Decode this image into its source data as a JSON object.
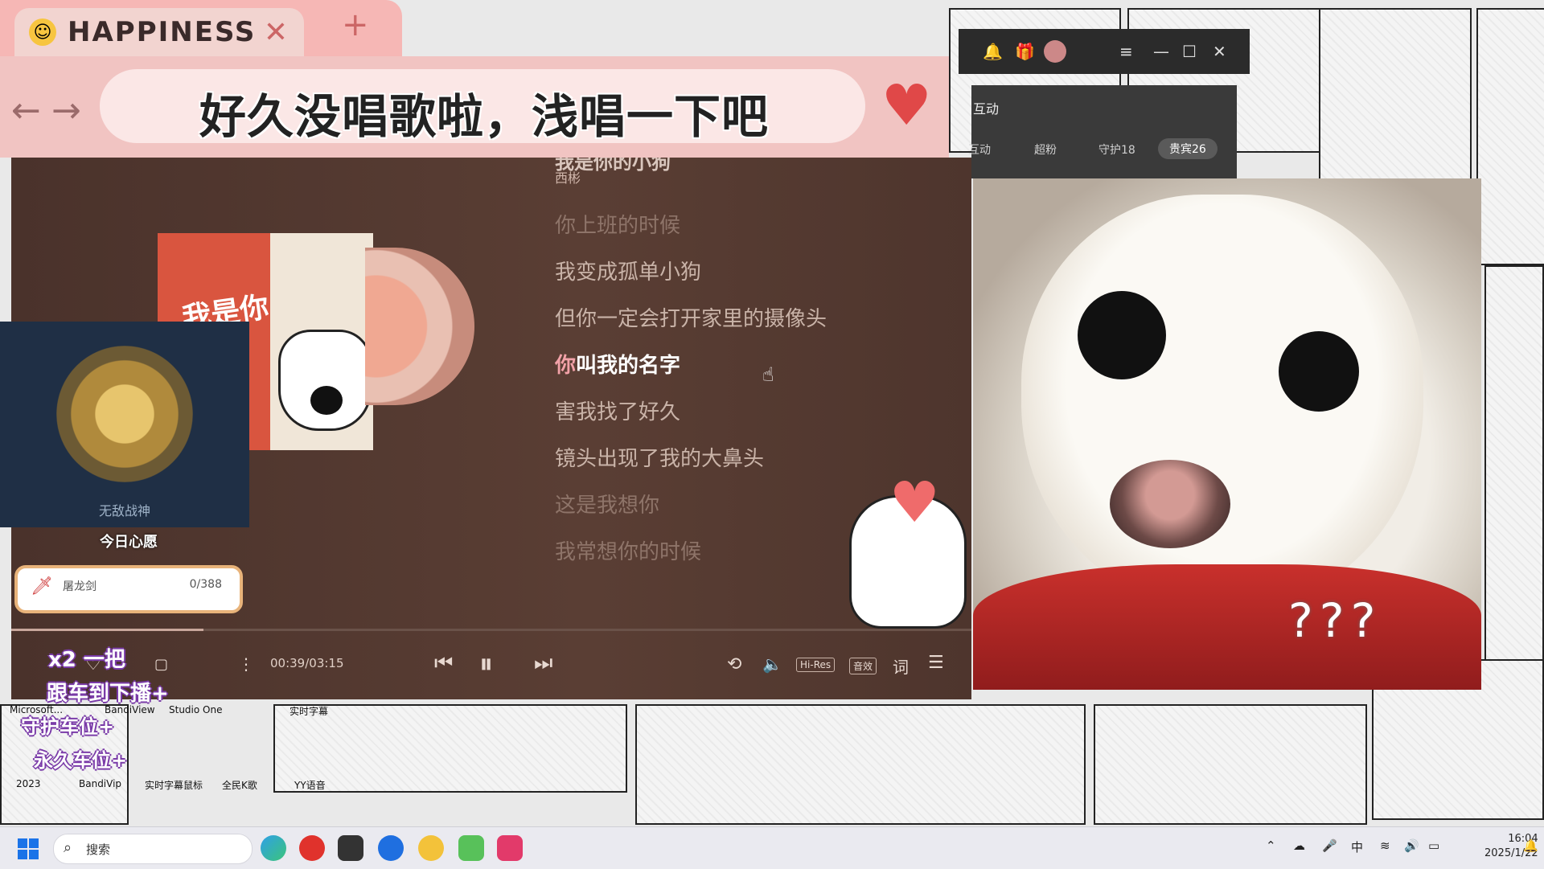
{
  "tab": {
    "title": "HAPPINESS",
    "close": "✕",
    "add": "+"
  },
  "address": {
    "text": "好久没唱歌啦，浅唱一下吧"
  },
  "player": {
    "song_title": "我是你的小狗",
    "artist": "西彬",
    "lyrics": [
      {
        "text": "你上班的时候",
        "state": "faded"
      },
      {
        "text": "我变成孤单小狗",
        "state": "normal"
      },
      {
        "text": "但你一定会打开家里的摄像头",
        "state": "normal"
      },
      {
        "highlight": "你",
        "rest": "叫我的名字",
        "state": "current"
      },
      {
        "text": "害我找了好久",
        "state": "normal"
      },
      {
        "text": "镜头出现了我的大鼻头",
        "state": "normal"
      },
      {
        "text": "这是我想你",
        "state": "faded"
      },
      {
        "text": "我常想你的时候",
        "state": "faded"
      }
    ],
    "album_cover_text": "我是你",
    "time": "00:39/03:15",
    "progress": 0.2,
    "chips": {
      "hires": "Hi-Res",
      "effect": "音效",
      "lyric": "词"
    }
  },
  "window": {
    "fan_title": "互动",
    "fan_tabs": [
      "互动",
      "超粉",
      "守护18",
      "贵宾26"
    ],
    "active_fan_tab": "贵宾26"
  },
  "left": {
    "badge_label": "无敌战神",
    "wish_title": "今日心愿",
    "wish_item": "屠龙剑",
    "wish_count": "0/388",
    "overlay_line1": "x2 一把",
    "overlay_line2": "跟车到下播+",
    "overlay_line3": "守护车位+",
    "overlay_line4": "永久车位+"
  },
  "desktop_labels": [
    "Microsoft...",
    "BandiView",
    "Studio One",
    "实时字幕",
    "2023",
    "BandiVip",
    "实时字幕鼠标",
    "全民K歌",
    "YY语音"
  ],
  "dog": {
    "qmarks": "???"
  },
  "taskbar": {
    "search": "搜索",
    "ime": "中",
    "time": "16:04",
    "date": "2025/1/22"
  },
  "colors": {
    "accent": "#f1c4c2",
    "player_bg": "#5a3e34",
    "highlight": "#f2a2a8"
  }
}
